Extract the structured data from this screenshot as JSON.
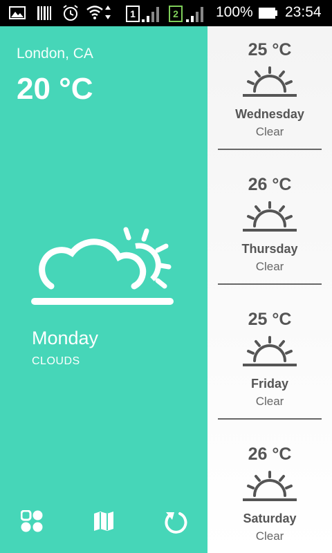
{
  "status_bar": {
    "battery_percent": "100%",
    "time": "23:54",
    "sim1_label": "1",
    "sim2_label": "2",
    "icons": [
      "gallery-icon",
      "barcode-icon",
      "alarm-icon",
      "wifi-icon",
      "sim1-signal-icon",
      "sim2-signal-icon",
      "battery-icon"
    ]
  },
  "current": {
    "location": "London, CA",
    "temperature": "20 °C",
    "day": "Monday",
    "condition": "CLOUDS",
    "icon": "clouds-sun-icon"
  },
  "bottom_bar": {
    "icons": [
      "grid-apps-icon",
      "map-icon",
      "refresh-icon"
    ]
  },
  "forecast": [
    {
      "temperature": "25 °C",
      "day": "Wednesday",
      "condition": "Clear",
      "icon": "sunrise-icon"
    },
    {
      "temperature": "26 °C",
      "day": "Thursday",
      "condition": "Clear",
      "icon": "sunrise-icon"
    },
    {
      "temperature": "25 °C",
      "day": "Friday",
      "condition": "Clear",
      "icon": "sunrise-icon"
    },
    {
      "temperature": "26 °C",
      "day": "Saturday",
      "condition": "Clear",
      "icon": "sunrise-icon"
    }
  ],
  "colors": {
    "accent": "#46d6b8",
    "forecast_text": "#555555"
  }
}
